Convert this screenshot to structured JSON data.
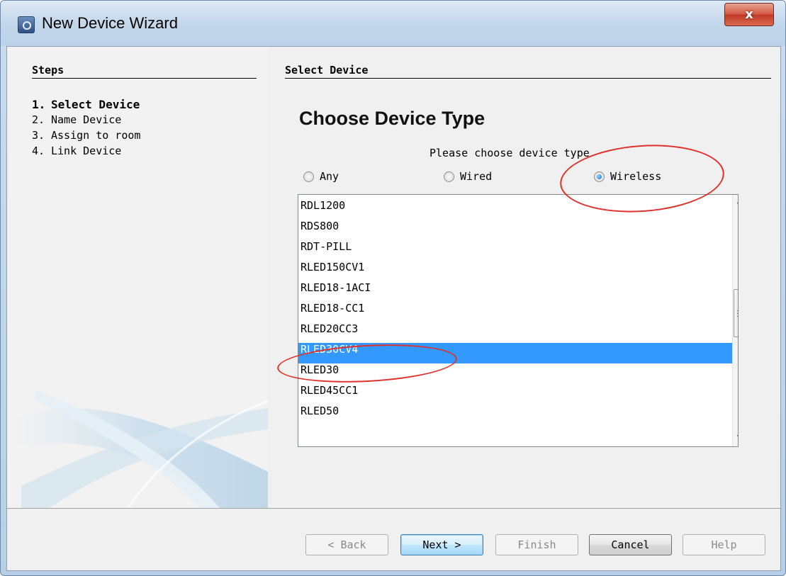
{
  "window": {
    "title": "New Device Wizard",
    "close_glyph": "x"
  },
  "steps": {
    "heading": "Steps",
    "items": [
      {
        "num": "1.",
        "label": "Select Device"
      },
      {
        "num": "2.",
        "label": "Name Device"
      },
      {
        "num": "3.",
        "label": "Assign to room"
      },
      {
        "num": "4.",
        "label": "Link Device"
      }
    ]
  },
  "panel": {
    "heading": "Select Device",
    "title": "Choose Device Type",
    "prompt": "Please choose device type"
  },
  "device_type": {
    "options": [
      "Any",
      "Wired",
      "Wireless"
    ],
    "selected": "Wireless"
  },
  "device_list": {
    "items": [
      "RDL1200",
      "RDS800",
      "RDT-PILL",
      "RLED150CV1",
      "RLED18-1ACI",
      "RLED18-CC1",
      "RLED20CC3",
      "RLED30CV4",
      "RLED30",
      "RLED45CC1",
      "RLED50"
    ],
    "selected": "RLED30CV4",
    "scroll_up_glyph": "▲",
    "scroll_down_glyph": "▼"
  },
  "buttons": {
    "back": "< Back",
    "next": "Next >",
    "finish": "Finish",
    "cancel": "Cancel",
    "help": "Help"
  },
  "colors": {
    "selection": "#3399ff",
    "annotation": "#e0302a"
  }
}
